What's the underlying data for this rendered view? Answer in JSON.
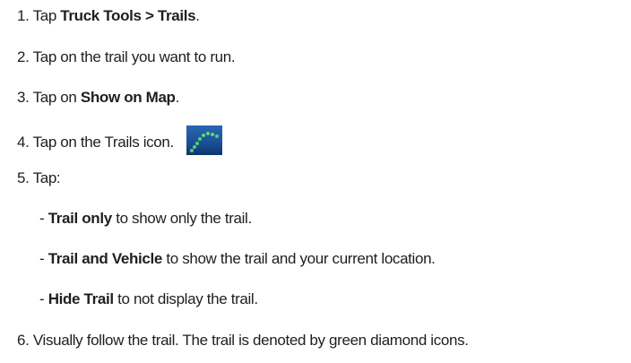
{
  "steps": {
    "s1": {
      "num": "1.",
      "text_a": "Tap ",
      "bold": "Truck Tools > Trails",
      "text_b": "."
    },
    "s2": {
      "num": "2.",
      "text": "Tap on the trail you want to run."
    },
    "s3": {
      "num": "3.",
      "text_a": "Tap on ",
      "bold": "Show on Map",
      "text_b": "."
    },
    "s4": {
      "num": "4.",
      "text": "Tap on the Trails icon.",
      "icon": "trails-icon"
    },
    "s5": {
      "num": "5.",
      "text": "Tap:"
    },
    "s6": {
      "num": "6.",
      "text": "Visually follow the trail. The trail is denoted by green diamond icons."
    }
  },
  "options": [
    {
      "dash": "- ",
      "bold": "Trail only",
      "text": " to show only the trail."
    },
    {
      "dash": "- ",
      "bold": "Trail and Vehicle",
      "text": " to show the trail and your current location."
    },
    {
      "dash": "- ",
      "bold": "Hide Trail",
      "text": " to not display the trail."
    }
  ],
  "colors": {
    "text": "#1f1f1f",
    "icon_background": "#1a4f95",
    "trail_dots": "#4fd36a"
  }
}
